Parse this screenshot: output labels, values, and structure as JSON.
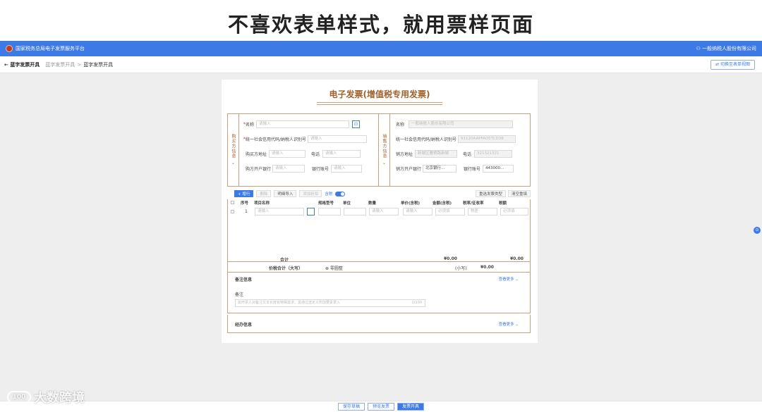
{
  "slide": {
    "title": "不喜欢表单样式，就用票样页面"
  },
  "topbar": {
    "title": "国家税务总局电子发票服务平台",
    "company": "⚇ 一般纳税人股份有限公司"
  },
  "crumbbar": {
    "back_icon": "←",
    "back_label": "蓝字发票开具",
    "crumb1": "蓝字发票开具",
    "sep": ">",
    "crumb2": "蓝字发票开具",
    "switch_label": "⇄ 切换至表单视图"
  },
  "invoice": {
    "title": "电子发票(增值税专用发票)",
    "buyer": {
      "side_label": "购买方信息 ⌄",
      "name_label": "名称",
      "name_placeholder": "请输入",
      "name_btn": "⊡",
      "tax_label": "统一社会信用代码/纳税人识别号",
      "tax_placeholder": "请输入",
      "addr_label": "购买方地址",
      "addr_placeholder": "请输入",
      "phone_label": "电话",
      "phone_placeholder": "请输入",
      "bank_label": "购方开户银行",
      "bank_placeholder": "请输入",
      "account_label": "银行账号",
      "account_placeholder": "请输入"
    },
    "seller": {
      "side_label": "销售方信息 ⌄",
      "name_label": "名称",
      "name_value": "一般纳税人股份有限公司",
      "tax_label": "统一社会信用代码/纳税人识别号",
      "tax_value": "91120AAPFAD5TCD38",
      "addr_label": "销方地址",
      "addr_value": "新城区雁栖路新城",
      "phone_label": "电话",
      "phone_value": "321321321",
      "bank_label": "销方开户银行",
      "bank_value": "北京银行...",
      "account_label": "银行账号",
      "account_value": "443000..."
    },
    "toolbar": {
      "add": "+ 增行",
      "delete": "删除",
      "import": "明细导入",
      "discount": "添加折扣",
      "tax_incl": "含税",
      "batch_type": "重选发票类型",
      "clear": "清空重填"
    },
    "columns": {
      "seq": "序号",
      "name": "项目名称",
      "spec": "规格型号",
      "unit": "单位",
      "qty": "数量",
      "price": "单价(含税)",
      "amount": "金额(含税)",
      "rate": "税率/征收率",
      "tax": "税额"
    },
    "row": {
      "seq": "1",
      "name_ph": "请输入",
      "price_ph": "请输入",
      "qty_ph": "请输入",
      "amount_ph": "必须填",
      "rate_ph": "税差",
      "tax_ph": "必须填"
    },
    "totals": {
      "label": "合计",
      "amount": "¥0.00",
      "tax": "¥0.00"
    },
    "price_total": {
      "label": "价税合计（大写）",
      "value": "⊗ 零圆整",
      "small_label": "(小写)",
      "small_value": "¥0.00"
    },
    "remarks": {
      "section": "备注信息",
      "more": "查看更多 ⌄",
      "label": "备注",
      "placeholder": "如开票人对备注文本长度有特殊需求，需通过选定义附加要素录入",
      "count": "0/200"
    },
    "agent": {
      "section": "经办信息",
      "more": "查看更多 ⌄"
    }
  },
  "bottom": {
    "save": "保存草稿",
    "preview": "预览发票",
    "issue": "发票开具"
  },
  "float_btn": "⊙",
  "watermark": {
    "icon": "100",
    "text": "大数跨境"
  }
}
